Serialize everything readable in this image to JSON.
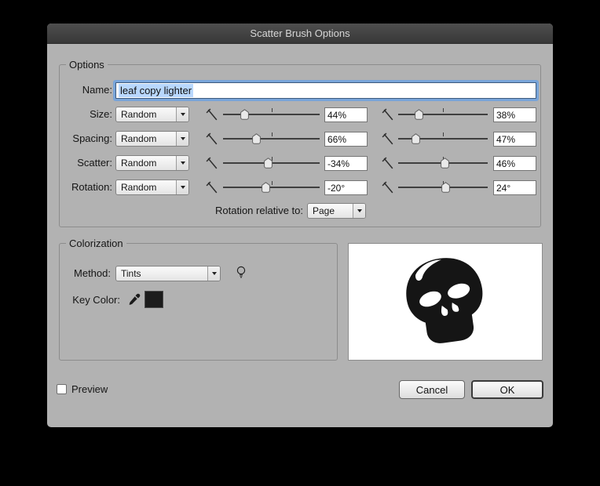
{
  "window": {
    "title": "Scatter Brush Options"
  },
  "options": {
    "group_label": "Options",
    "name_label": "Name:",
    "name_value": "leaf copy lighter",
    "rows": [
      {
        "label": "Size:",
        "mode": "Random",
        "value1": "44%",
        "thumb1": 22,
        "value2": "38%",
        "thumb2": 23
      },
      {
        "label": "Spacing:",
        "mode": "Random",
        "value1": "66%",
        "thumb1": 34,
        "value2": "47%",
        "thumb2": 19
      },
      {
        "label": "Scatter:",
        "mode": "Random",
        "value1": "-34%",
        "thumb1": 46,
        "value2": "46%",
        "thumb2": 52
      },
      {
        "label": "Rotation:",
        "mode": "Random",
        "value1": "-20°",
        "thumb1": 44,
        "value2": "24°",
        "thumb2": 53
      }
    ],
    "rotation_relative_label": "Rotation relative to:",
    "rotation_relative_value": "Page"
  },
  "colorization": {
    "group_label": "Colorization",
    "method_label": "Method:",
    "method_value": "Tints",
    "key_color_label": "Key Color:",
    "key_color_hex": "#1c1c1c"
  },
  "footer": {
    "preview_label": "Preview",
    "cancel_label": "Cancel",
    "ok_label": "OK"
  },
  "colors": {
    "selection": "#b8d7fd",
    "focus_ring": "#79a5d9",
    "dialog_bg": "#b2b2b2"
  }
}
